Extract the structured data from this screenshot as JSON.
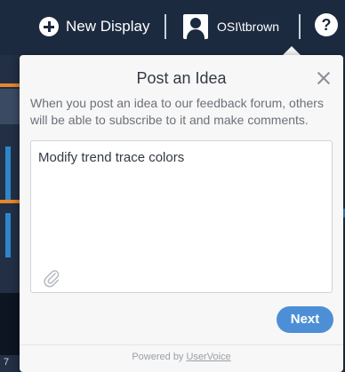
{
  "toolbar": {
    "new_display_label": "New Display",
    "username": "OSI\\tbrown",
    "help_label": "?"
  },
  "modal": {
    "title": "Post an Idea",
    "description": "When you post an idea to our feedback forum, others will be able to subscribe to it and make comments.",
    "idea_text": "Modify trend trace colors",
    "next_label": "Next",
    "footer_prefix": "Powered by ",
    "footer_link": "UserVoice"
  },
  "background": {
    "corner_text": "7"
  },
  "colors": {
    "topbar": "#1c2a40",
    "accent_orange": "#e8862a",
    "accent_blue": "#2e86c9",
    "button_blue": "#4d8fd6"
  },
  "icons": {
    "new_display": "plus-circle-icon",
    "user": "user-avatar-icon",
    "help": "help-icon",
    "close": "close-icon",
    "attach": "paperclip-icon"
  }
}
